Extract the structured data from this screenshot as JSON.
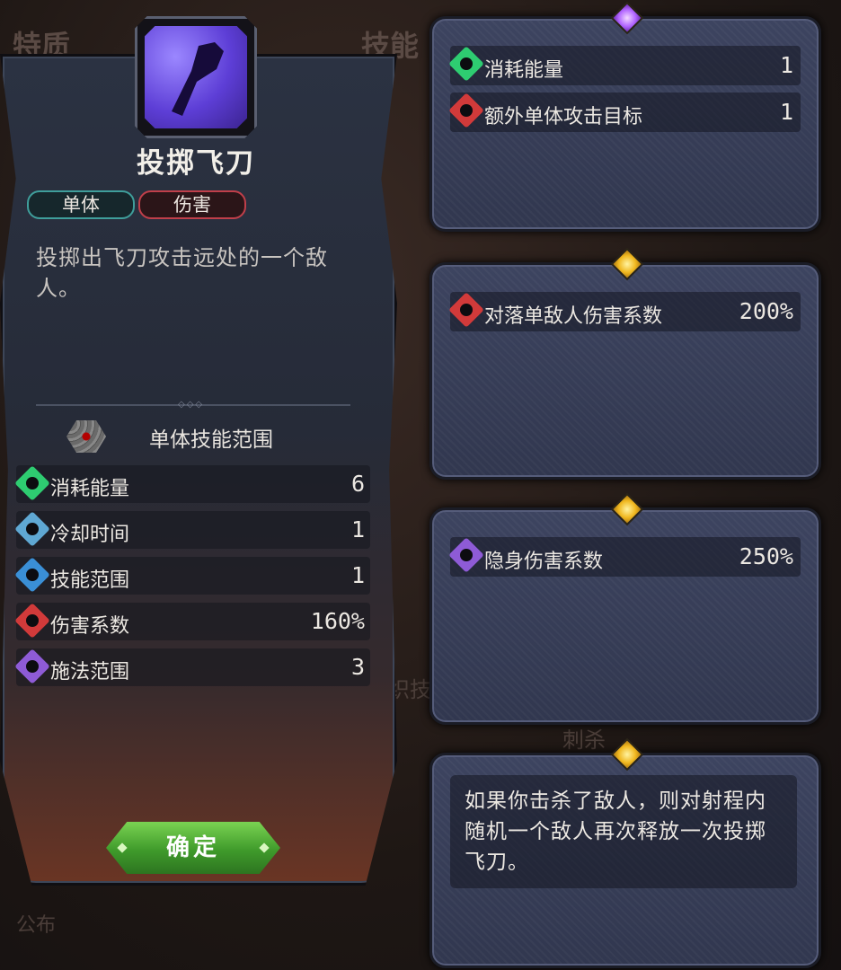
{
  "background": {
    "tab_traits": "特质",
    "tab_skills": "技能",
    "tab_skill_short": "织技",
    "tab_stab": "刺杀",
    "bottom_left": "公布"
  },
  "skill": {
    "name": "投掷飞刀",
    "tags": [
      "单体",
      "伤害"
    ],
    "description": "投掷出飞刀攻击远处的一个敌人。",
    "range_title": "单体技能范围",
    "stats": [
      {
        "label": "消耗能量",
        "value": "6",
        "icon": "energy-icon",
        "color": "#2ecc71"
      },
      {
        "label": "冷却时间",
        "value": "1",
        "icon": "cooldown-icon",
        "color": "#5fa8d3"
      },
      {
        "label": "技能范围",
        "value": "1",
        "icon": "range-icon",
        "color": "#3a8fd6"
      },
      {
        "label": "伤害系数",
        "value": "160%",
        "icon": "damage-icon",
        "color": "#d13a3a"
      },
      {
        "label": "施法范围",
        "value": "3",
        "icon": "cast-range-icon",
        "color": "#8e5bd6"
      }
    ],
    "confirm_label": "确定"
  },
  "upgrades": [
    {
      "gem_color": "purple",
      "rows": [
        {
          "label": "消耗能量",
          "value": "1",
          "icon": "energy-icon",
          "color": "#2ecc71"
        },
        {
          "label": "额外单体攻击目标",
          "value": "1",
          "icon": "target-icon",
          "color": "#d13a3a"
        }
      ]
    },
    {
      "gem_color": "gold",
      "rows": [
        {
          "label": "对落单敌人伤害系数",
          "value": "200%",
          "icon": "lone-target-icon",
          "color": "#d13a3a"
        }
      ]
    },
    {
      "gem_color": "gold",
      "rows": [
        {
          "label": "隐身伤害系数",
          "value": "250%",
          "icon": "stealth-icon",
          "color": "#8e5bd6"
        }
      ]
    },
    {
      "gem_color": "gold",
      "description": "如果你击杀了敌人，则对射程内随机一个敌人再次释放一次投掷飞刀。"
    }
  ]
}
